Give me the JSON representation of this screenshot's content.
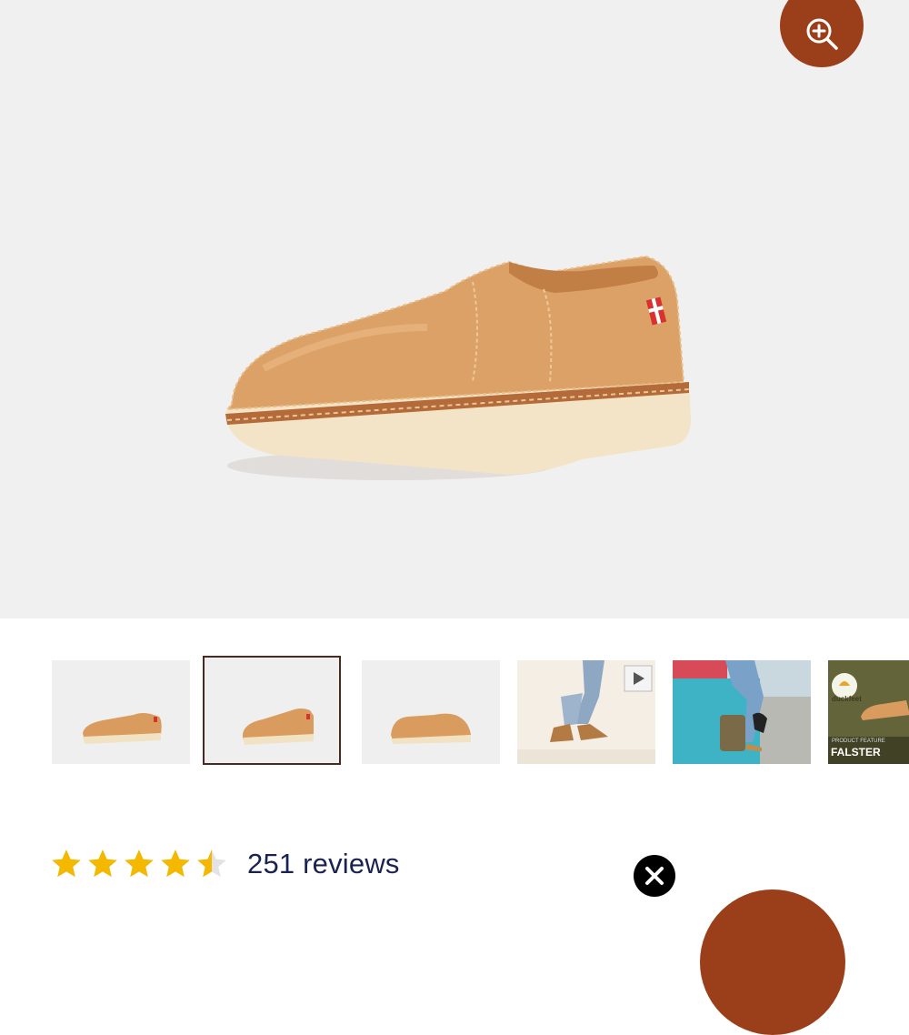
{
  "gallery": {
    "zoom_icon": "zoom-in-icon",
    "selected_index": 1,
    "thumbnails": [
      {
        "kind": "shoe-side"
      },
      {
        "kind": "shoe-angle"
      },
      {
        "kind": "shoe-back"
      },
      {
        "kind": "video",
        "icon": "play-icon"
      },
      {
        "kind": "lifestyle"
      },
      {
        "kind": "product-feature",
        "brand": "duckfeet",
        "caption_small": "PRODUCT FEATURE",
        "caption_large": "FALSTER"
      }
    ]
  },
  "rating": {
    "value": 4.5,
    "max": 5,
    "star_color": "#f5b800",
    "reviews_label": "251 reviews"
  },
  "overlay": {
    "close_icon": "close-icon"
  },
  "colors": {
    "accent": "#9a3f1a",
    "hero_background": "#f0f0f0",
    "text_dark": "#1a2350"
  }
}
